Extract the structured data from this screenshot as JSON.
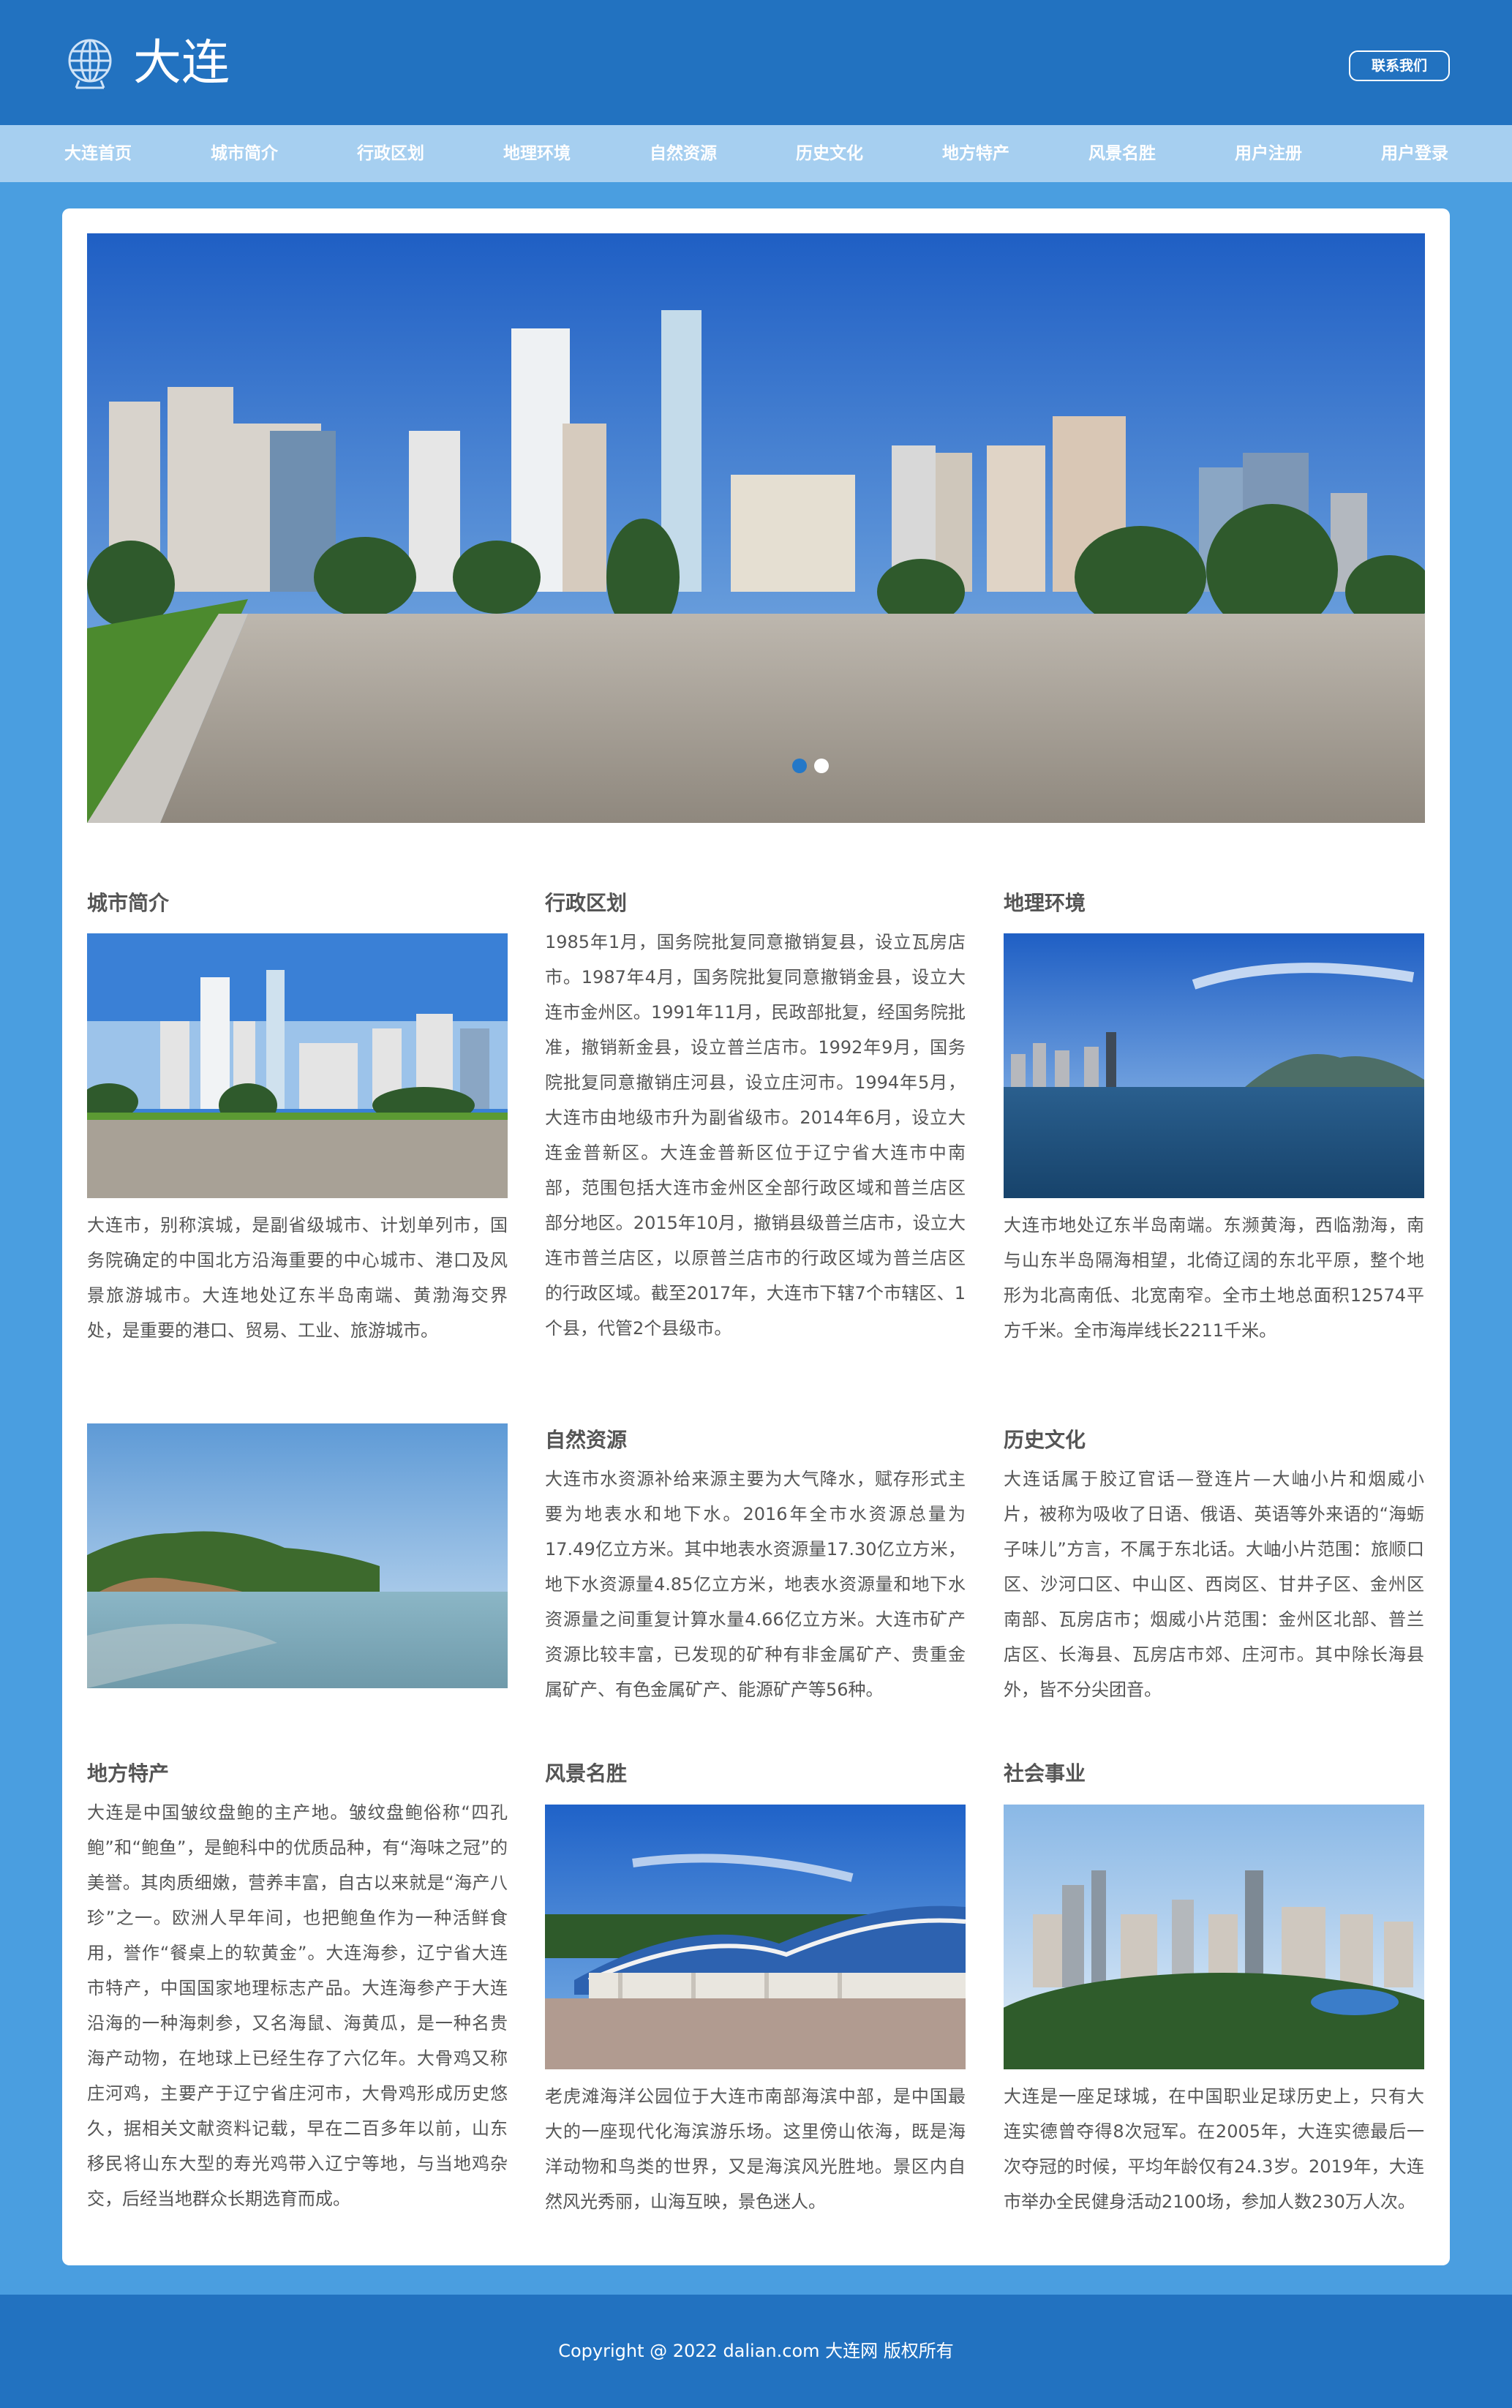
{
  "header": {
    "site_title": "大连",
    "contact_label": "联系我们"
  },
  "nav": {
    "items": [
      "大连首页",
      "城市简介",
      "行政区划",
      "地理环境",
      "自然资源",
      "历史文化",
      "地方特产",
      "风景名胜",
      "用户注册",
      "用户登录"
    ]
  },
  "carousel": {
    "slides": 2,
    "active": 1
  },
  "sections": {
    "city_intro": {
      "title": "城市简介",
      "text": "大连市，别称滨城，是副省级城市、计划单列市，国务院确定的中国北方沿海重要的中心城市、港口及风景旅游城市。大连地处辽东半岛南端、黄渤海交界处，是重要的港口、贸易、工业、旅游城市。"
    },
    "admin_division": {
      "title": "行政区划",
      "text": "1985年1月，国务院批复同意撤销复县，设立瓦房店市。1987年4月，国务院批复同意撤销金县，设立大连市金州区。1991年11月，民政部批复，经国务院批准，撤销新金县，设立普兰店市。1992年9月，国务院批复同意撤销庄河县，设立庄河市。1994年5月，大连市由地级市升为副省级市。2014年6月，设立大连金普新区。大连金普新区位于辽宁省大连市中南部，范围包括大连市金州区全部行政区域和普兰店区部分地区。2015年10月，撤销县级普兰店市，设立大连市普兰店区，以原普兰店市的行政区域为普兰店区的行政区域。截至2017年，大连市下辖7个市辖区、1个县，代管2个县级市。"
    },
    "geography": {
      "title": "地理环境",
      "text": "大连市地处辽东半岛南端。东濒黄海，西临渤海，南与山东半岛隔海相望，北倚辽阔的东北平原，整个地形为北高南低、北宽南窄。全市土地总面积12574平方千米。全市海岸线长2211千米。"
    },
    "natural_resources": {
      "title": "自然资源",
      "text": "大连市水资源补给来源主要为大气降水，赋存形式主要为地表水和地下水。2016年全市水资源总量为17.49亿立方米。其中地表水资源量17.30亿立方米，地下水资源量4.85亿立方米，地表水资源量和地下水资源量之间重复计算水量4.66亿立方米。大连市矿产资源比较丰富，已发现的矿种有非金属矿产、贵重金属矿产、有色金属矿产、能源矿产等56种。"
    },
    "history_culture": {
      "title": "历史文化",
      "text": "大连话属于胶辽官话—登连片—大岫小片和烟威小片，被称为吸收了日语、俄语、英语等外来语的“海蛎子味儿”方言，不属于东北话。大岫小片范围：旅顺口区、沙河口区、中山区、西岗区、甘井子区、金州区南部、瓦房店市；烟威小片范围：金州区北部、普兰店区、长海县、瓦房店市郊、庄河市。其中除长海县外，皆不分尖团音。"
    },
    "local_specialties": {
      "title": "地方特产",
      "text": "大连是中国皱纹盘鲍的主产地。皱纹盘鲍俗称“四孔鲍”和“鲍鱼”，是鲍科中的优质品种，有“海味之冠”的美誉。其肉质细嫩，营养丰富，自古以来就是“海产八珍”之一。欧洲人早年间，也把鲍鱼作为一种活鲜食用，誉作“餐桌上的软黄金”。大连海参，辽宁省大连市特产，中国国家地理标志产品。大连海参产于大连沿海的一种海刺参，又名海鼠、海黄瓜，是一种名贵海产动物，在地球上已经生存了六亿年。大骨鸡又称庄河鸡，主要产于辽宁省庄河市，大骨鸡形成历史悠久，据相关文献资料记载，早在二百多年以前，山东移民将山东大型的寿光鸡带入辽宁等地，与当地鸡杂交，后经当地群众长期选育而成。"
    },
    "scenic_spots": {
      "title": "风景名胜",
      "text": "老虎滩海洋公园位于大连市南部海滨中部，是中国最大的一座现代化海滨游乐场。这里傍山依海，既是海洋动物和鸟类的世界，又是海滨风光胜地。景区内自然风光秀丽，山海互映，景色迷人。"
    },
    "social_affairs": {
      "title": "社会事业",
      "text": "大连是一座足球城，在中国职业足球历史上，只有大连实德曾夺得8次冠军。在2005年，大连实德最后一次夺冠的时候，平均年龄仅有24.3岁。2019年，大连市举办全民健身活动2100场，参加人数230万人次。"
    }
  },
  "footer": {
    "copyright": "Copyright @ 2022 dalian.com 大连网 版权所有"
  },
  "colors": {
    "header_bg": "#2272c0",
    "nav_bg": "#a6cff0",
    "page_bg": "#4a9ee0",
    "card_bg": "#ffffff"
  },
  "icons": {
    "logo": "globe-logo-icon"
  }
}
